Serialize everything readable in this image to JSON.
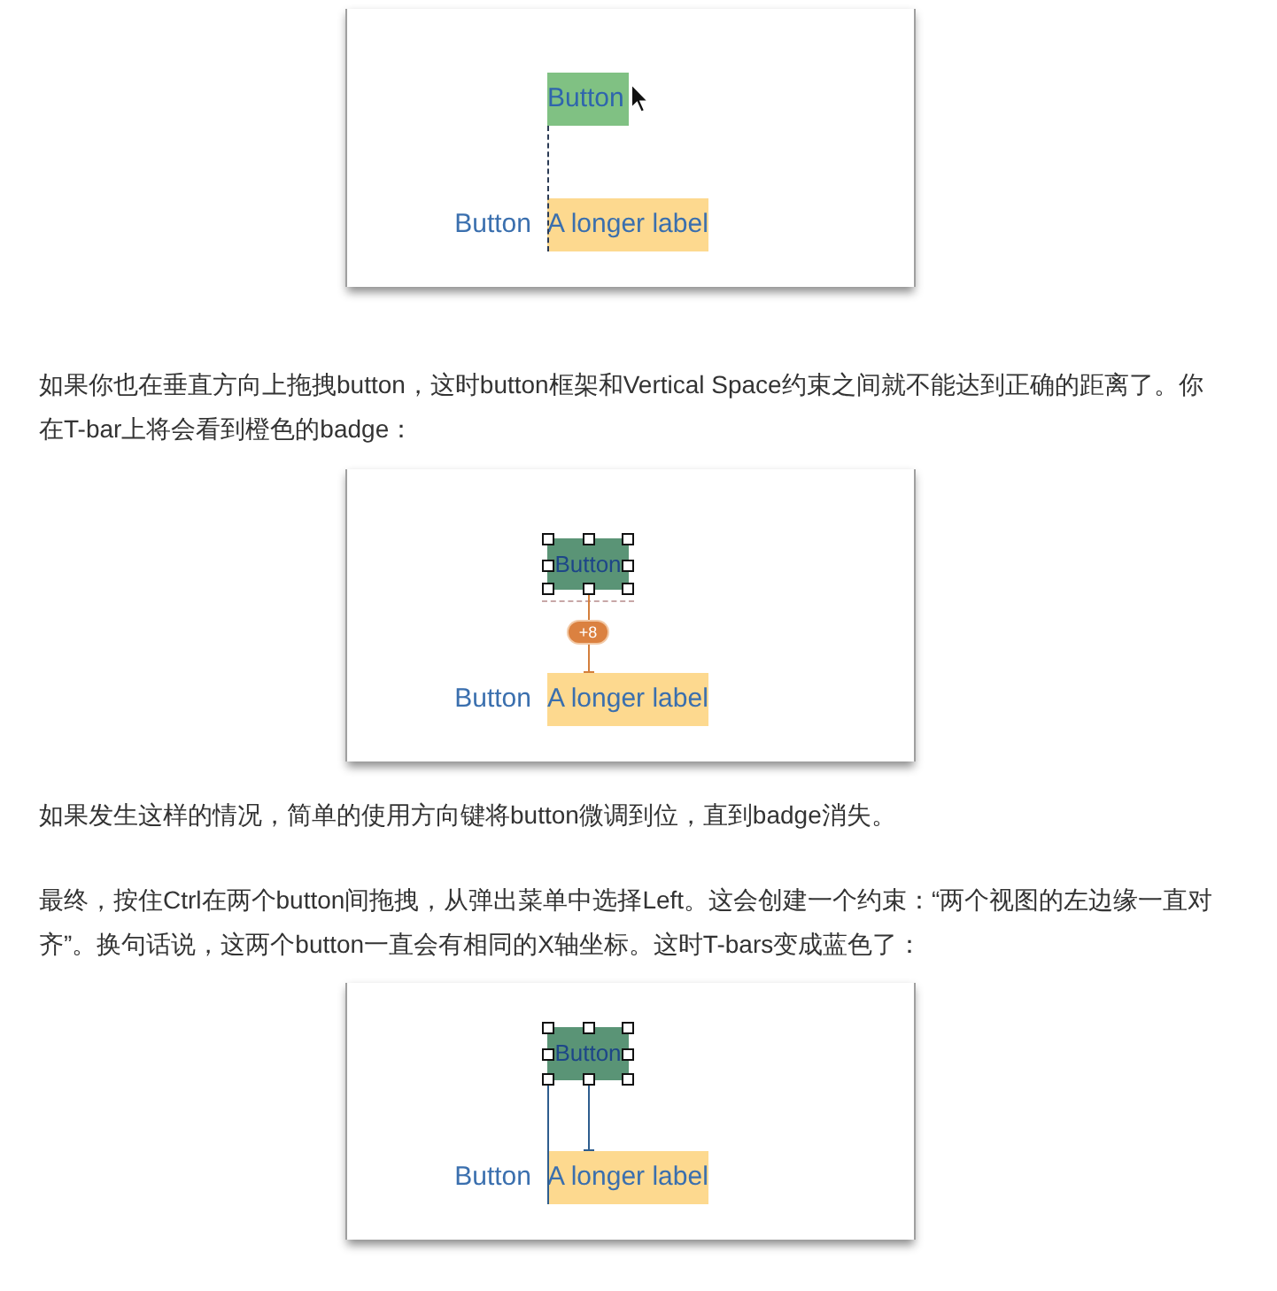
{
  "content": [
    {
      "kind": "figure",
      "top_button": {
        "label": "Button",
        "selected": false
      },
      "pointer": true,
      "constraint": {
        "kind": "guide"
      },
      "side_label": "Button",
      "long_label": "A longer label"
    },
    {
      "kind": "paragraph",
      "text": "如果你也在垂直方向上拖拽button，这时button框架和Vertical Space约束之间就不能达到正确的距离了。你在T-bar上将会看到橙色的badge："
    },
    {
      "kind": "figure",
      "top_button": {
        "label": "Button",
        "selected": true
      },
      "pointer": false,
      "constraint": {
        "kind": "misplaced",
        "badge": "+8"
      },
      "side_label": "Button",
      "long_label": "A longer label"
    },
    {
      "kind": "paragraph",
      "text": "如果发生这样的情况，简单的使用方向键将button微调到位，直到badge消失。"
    },
    {
      "kind": "paragraph",
      "text": "最终，按住Ctrl在两个button间拖拽，从弹出菜单中选择Left。这会创建一个约束：“两个视图的左边缘一直对齐”。换句话说，这两个button一直会有相同的X轴坐标。这时T-bars变成蓝色了："
    },
    {
      "kind": "figure",
      "top_button": {
        "label": "Button",
        "selected": true
      },
      "pointer": false,
      "constraint": {
        "kind": "aligned"
      },
      "side_label": "Button",
      "long_label": "A longer label"
    }
  ]
}
